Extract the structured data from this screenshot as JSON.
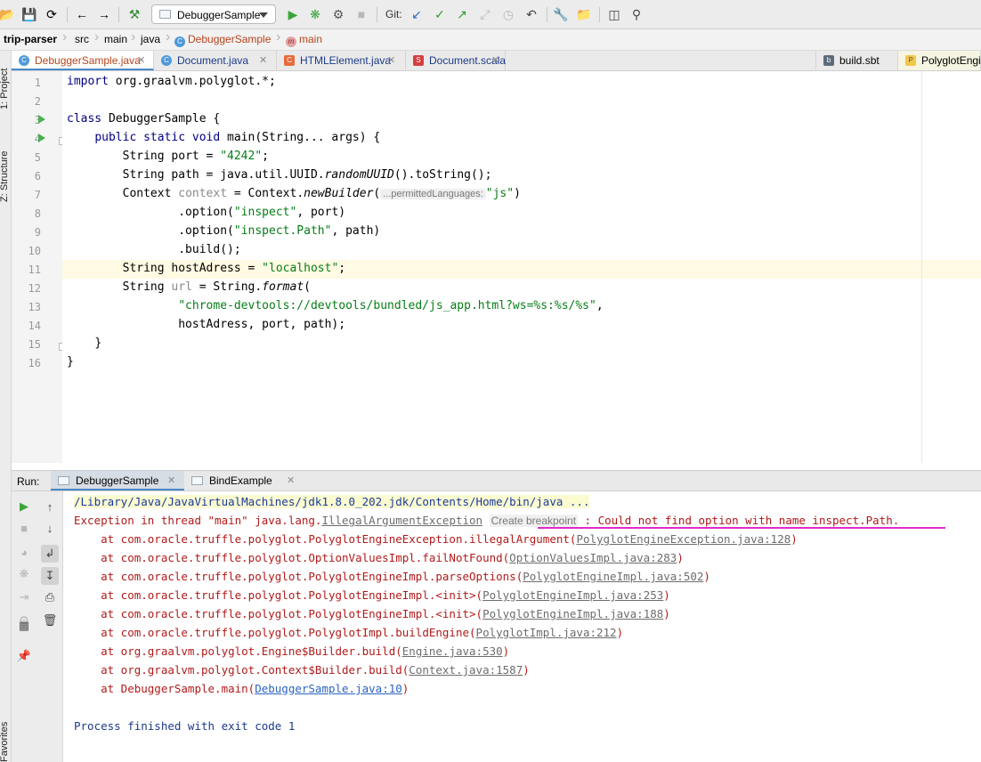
{
  "toolbar": {
    "run_config": "DebuggerSample",
    "git_label": "Git:"
  },
  "breadcrumb": {
    "project": "trip-parser",
    "items": [
      "src",
      "main",
      "java"
    ],
    "class_name": "DebuggerSample",
    "method_name": "main"
  },
  "side_panels": {
    "project": "1: Project",
    "structure": "Z: Structure",
    "favorites": "Favorites"
  },
  "tabs": [
    {
      "label": "DebuggerSample.java",
      "active": true
    },
    {
      "label": "Document.java"
    },
    {
      "label": "HTMLElement.java"
    },
    {
      "label": "Document.scala"
    },
    {
      "label": "build.sbt"
    },
    {
      "label": "PolyglotEngin"
    }
  ],
  "editor": {
    "line_numbers": [
      "1",
      "2",
      "3",
      "4",
      "5",
      "6",
      "7",
      "8",
      "9",
      "10",
      "11",
      "12",
      "13",
      "14",
      "15",
      "16"
    ],
    "code": {
      "l1_kw": "import",
      "l1_rest": " org.graalvm.polyglot.*;",
      "l3_kw": "class",
      "l3_rest": " DebuggerSample {",
      "l4_kw": "public static void",
      "l4_rest": " main(String... args) {",
      "l5_a": "String port = ",
      "l5_str": "\"4242\"",
      "l5_b": ";",
      "l6_a": "String path = java.util.UUID.",
      "l6_it": "randomUUID",
      "l6_b": "().toString();",
      "l7_a": "Context ",
      "l7_dim": "context",
      "l7_b": " = Context.",
      "l7_it": "newBuilder",
      "l7_c": "(",
      "l7_hint": "...permittedLanguages:",
      "l7_str": "\"js\"",
      "l7_d": ")",
      "l8_a": ".option(",
      "l8_str": "\"inspect\"",
      "l8_b": ", port)",
      "l9_a": ".option(",
      "l9_str": "\"inspect.Path\"",
      "l9_b": ", path)",
      "l10": ".build();",
      "l11_a": "String hostAdress = ",
      "l11_str": "\"localhost\"",
      "l11_b": ";",
      "l12_a": "String ",
      "l12_dim": "url",
      "l12_b": " = String.",
      "l12_it": "format",
      "l12_c": "(",
      "l13_str": "\"chrome-devtools://devtools/bundled/js_app.html?ws=%s:%s/%s\"",
      "l13_b": ",",
      "l14": "hostAdress, port, path);",
      "l15": "}",
      "l16": "}"
    }
  },
  "run_panel": {
    "label": "Run:",
    "tabs": [
      {
        "label": "DebuggerSample",
        "active": true
      },
      {
        "label": "BindExample"
      }
    ]
  },
  "console": {
    "command": "/Library/Java/JavaVirtualMachines/jdk1.8.0_202.jdk/Contents/Home/bin/java ...",
    "exception_prefix": "Exception in thread \"main\" java.lang.",
    "exception_class": "IllegalArgumentException",
    "create_label": "Create",
    "breakpoint_label": "breakpoint",
    "exception_message": " : Could not find option with name inspect.Path.",
    "stack": [
      {
        "prefix": "    at com.oracle.truffle.polyglot.PolyglotEngineException.illegalArgument(",
        "link": "PolyglotEngineException.java:128",
        "suffix": ")"
      },
      {
        "prefix": "    at com.oracle.truffle.polyglot.OptionValuesImpl.failNotFound(",
        "link": "OptionValuesImpl.java:283",
        "suffix": ")"
      },
      {
        "prefix": "    at com.oracle.truffle.polyglot.PolyglotEngineImpl.parseOptions(",
        "link": "PolyglotEngineImpl.java:502",
        "suffix": ")"
      },
      {
        "prefix": "    at com.oracle.truffle.polyglot.PolyglotEngineImpl.<init>(",
        "link": "PolyglotEngineImpl.java:253",
        "suffix": ")"
      },
      {
        "prefix": "    at com.oracle.truffle.polyglot.PolyglotEngineImpl.<init>(",
        "link": "PolyglotEngineImpl.java:188",
        "suffix": ")"
      },
      {
        "prefix": "    at com.oracle.truffle.polyglot.PolyglotImpl.buildEngine(",
        "link": "PolyglotImpl.java:212",
        "suffix": ")"
      },
      {
        "prefix": "    at org.graalvm.polyglot.Engine$Builder.build(",
        "link": "Engine.java:530",
        "suffix": ")"
      },
      {
        "prefix": "    at org.graalvm.polyglot.Context$Builder.build(",
        "link": "Context.java:1587",
        "suffix": ")"
      },
      {
        "prefix": "    at DebuggerSample.main(",
        "link": "DebuggerSample.java:10",
        "suffix": ")"
      }
    ],
    "finish": "Process finished with exit code 1"
  }
}
